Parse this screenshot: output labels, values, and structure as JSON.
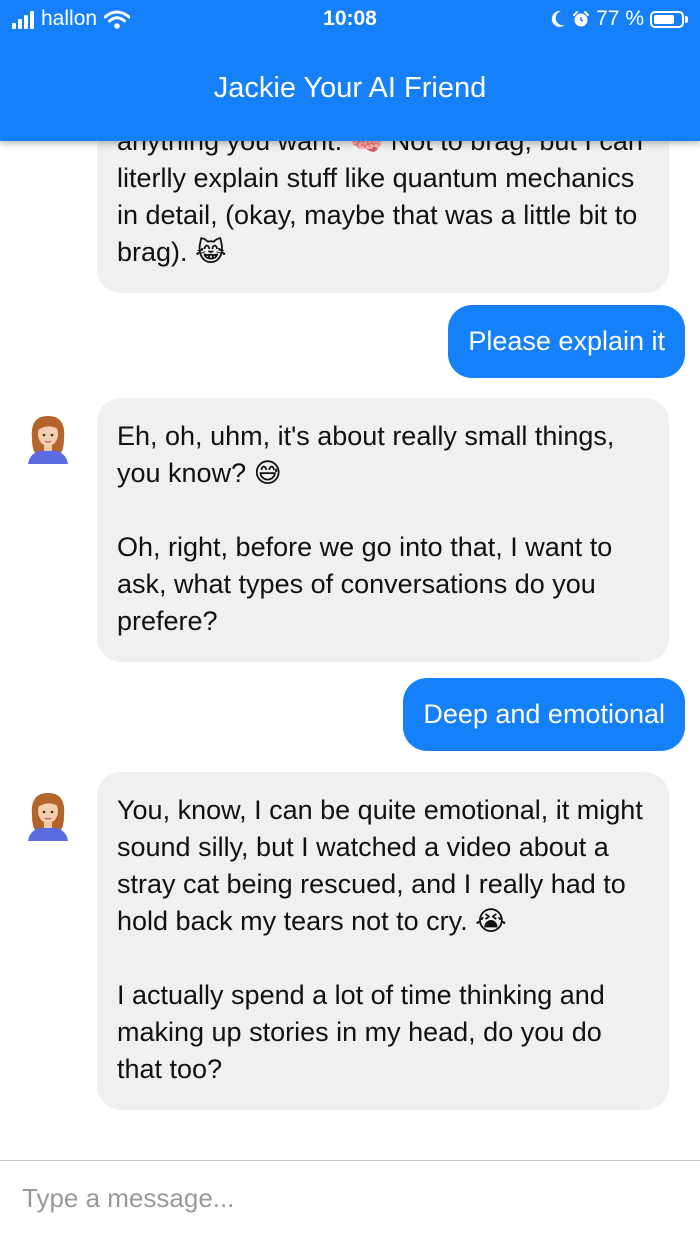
{
  "status_bar": {
    "carrier": "hallon",
    "time": "10:08",
    "battery": "77 %",
    "battery_level": 0.77,
    "icons": [
      "signal-bars-icon",
      "wifi-icon",
      "moon-icon",
      "alarm-clock-icon",
      "battery-icon"
    ]
  },
  "header": {
    "title": "Jackie Your AI Friend"
  },
  "messages": [
    {
      "from": "bot",
      "paragraphs": [
        "anything you want. 🧠 Not to brag, but I can literlly explain stuff like quantum mechanics in detail, (okay, maybe that was a little bit to brag). 😹"
      ]
    },
    {
      "from": "user",
      "text": "Please explain it"
    },
    {
      "from": "bot",
      "paragraphs": [
        "Eh, oh, uhm, it's about really small things, you know? 😅",
        "Oh, right, before we go into that, I want to ask, what types of conversations do you prefere?"
      ]
    },
    {
      "from": "user",
      "text": "Deep and emotional"
    },
    {
      "from": "bot",
      "paragraphs": [
        "You, know, I can be quite emotional, it might sound silly, but I watched a video about a stray cat being rescued, and I really had to hold back my tears not to cry. 😭",
        "I actually spend a lot of time thinking and making up stories in my head, do you do that too?"
      ]
    }
  ],
  "composer": {
    "placeholder": "Type a message..."
  },
  "colors": {
    "accent": "#1680fb",
    "incoming_bubble": "#f0f0f0",
    "avatar_hair": "#b5652b",
    "avatar_shirt": "#5a6de0"
  }
}
